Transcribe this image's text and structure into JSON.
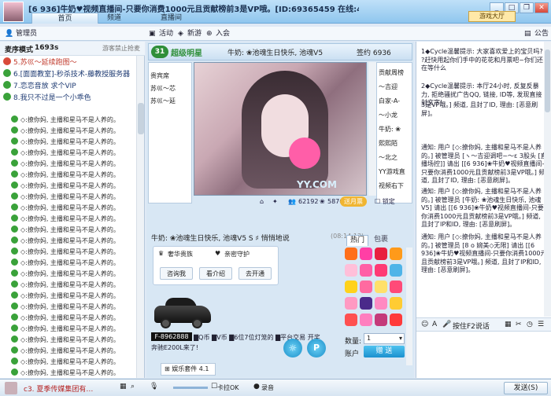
{
  "window": {
    "title": "[6 936]牛奶♥视频直播间-只要你消费1000元且贡献榜前3是VP哦。[ID:69365459 在线:455]",
    "game_hall": "游戏大厅",
    "tabs": [
      "首页",
      "频道",
      "直播间"
    ]
  },
  "toolbar": {
    "admin": "管理员",
    "activity": "活动",
    "new_game": "新游",
    "join": "入会",
    "announce": "公告"
  },
  "left": {
    "mode_label": "麦序模式",
    "mode_time": "1693s",
    "ban_text": "游客禁止抢麦",
    "mic_list": [
      {
        "num": "5.",
        "name": "苏巛〜延续跑图〜",
        "color": "#c0392b"
      },
      {
        "num": "6.",
        "name": "[面面教室]-秒杀技术-藤教授服务器",
        "color": "#1f3b73"
      },
      {
        "num": "7.",
        "name": "恋恋音放 求个VIP",
        "color": "#1f3b73"
      },
      {
        "num": "8.",
        "name": "我只不过是一个小乖色",
        "color": "#1f3b73"
      }
    ],
    "messages_count": 24,
    "message_text": "◇:撩你妈, 主播和星马不是人养的。"
  },
  "room": {
    "num": "31",
    "title": "超级明星",
    "host_line": "牛奶: ❀池魂生日快乐, 池魂V5",
    "sign": "签约 6936",
    "side_users": [
      "贵宾席",
      "苏巛〜芯",
      "苏巛〜延"
    ],
    "right_users": [
      "贡献周榜",
      "〜吉迎",
      "白家-A-",
      "〜小龙",
      "牛奶: ❀",
      "熙熙陌",
      "〜北之",
      "YY游戏直",
      "视频右下"
    ],
    "video_brand": "YY.COM",
    "stats": {
      "count1": "62192",
      "count2": "5876"
    },
    "enter_btn": "送月票",
    "lock_label": "锁定"
  },
  "chat": {
    "head_text": "牛奶: ❀池魂生日快乐, 池魂V5  S  ♯ 悄悄地说",
    "time": "(08:14:13)",
    "tab_hot": "热门",
    "tab_bag": "包裹",
    "vip_buy": "奢华贵族",
    "vip_guard": "亲密守护",
    "btn_ask": "咨询我",
    "btn_view": "看介绍",
    "btn_open": "去开通",
    "plate": "F-8962888",
    "car_caption": "奔驰E200L来了!",
    "currency": "▇Q币 ▇V币 ▇6位7位灯笼的 ▇平台交易 开奖",
    "qty_label": "数量:",
    "qty_value": "1",
    "acct_label": "账户",
    "send_gift": "赠 送",
    "entertain": "娱乐套件 4.1",
    "gift_colors": [
      "#ff6f1a",
      "#ff3fa5",
      "#e8203f",
      "#ff9a1a",
      "#ffbfd9",
      "#ff5fa6",
      "#ff3a75",
      "#4fb4e8",
      "#ffd21a",
      "#ff6aa0",
      "#ffe06a",
      "#ff4a78",
      "#ff9ac2",
      "#4a2a8a",
      "#ff8ac2",
      "#ffcc33",
      "#ff5050",
      "#ff7fbf",
      "#c43a7a",
      "#ff3a3a"
    ]
  },
  "right": {
    "messages": [
      "1◆Cycle温馨提示: 大家喜欢爱上的宝贝吗? ?赶快用起你们手中的花花和月票吧~你们还在等什么",
      "2◆Cycle温馨提示: 本厅24小时, 反复反暴力, 拒绝骚扰广告QQ, 链接, ID等, 发现直接封文字!",
      "3是VP哦。] 频道, 且封了ID, 理由: [恶意刷屏]。",
      "通知: 用户 [◇:撩你妈, 主播和星马不是人养的。] 被管理员 [ヽ〜吉迎调吧~〜ε 3股头 [直播场控]] 请出 [[6 936]❀牛奶♥视频直播间-只要你消费1000元且贡献榜前3是VP哦。] 频道, 且封了ID, 理由: [恶意刷屏]。",
      "通知: 用户 [◇:撩你妈, 主播和星马不是人养的。] 被管理员 [牛奶: ❀池魂生日快乐, 池魂V5] 请出 [[6 936]❀牛奶♥视频直播间-只要你消费1000元且贡献榜前3是VP哦。] 频道, 且封了IP和ID, 理由: [恶意刷屏]。",
      "通知: 用户 [◇:撩你妈, 主播和星马不是人养的。] 被管理员 [8 o 婉美◇无限] 请出 [[6 936]❀牛奶♥视频直播间-只要你消费1000元且贡献榜前3是VP哦。] 频道, 且封了IP和ID, 理由: [恶意刷屏]。"
    ],
    "f2_label": "按住F2说话"
  },
  "bottom": {
    "left_text": "c3. 夏季传媒集团有…",
    "mix_label": "卡拉OK",
    "rec_label": "录音",
    "send_label": "发送(S)"
  }
}
